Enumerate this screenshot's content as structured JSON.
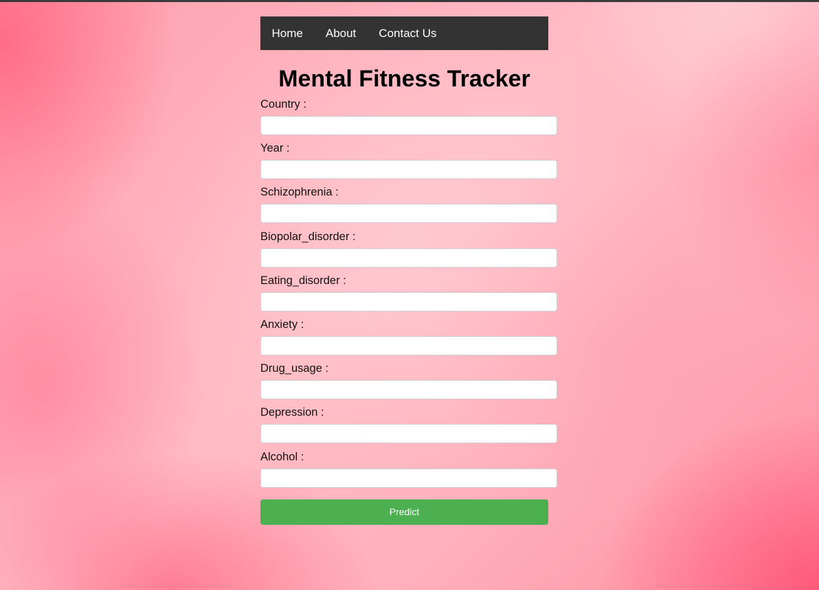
{
  "nav": {
    "items": [
      {
        "label": "Home"
      },
      {
        "label": "About"
      },
      {
        "label": "Contact Us"
      }
    ]
  },
  "page": {
    "title": "Mental Fitness Tracker"
  },
  "form": {
    "fields": [
      {
        "label": "Country :",
        "value": ""
      },
      {
        "label": "Year :",
        "value": ""
      },
      {
        "label": "Schizophrenia :",
        "value": ""
      },
      {
        "label": "Biopolar_disorder :",
        "value": ""
      },
      {
        "label": "Eating_disorder :",
        "value": ""
      },
      {
        "label": "Anxiety :",
        "value": ""
      },
      {
        "label": "Drug_usage :",
        "value": ""
      },
      {
        "label": "Depression :",
        "value": ""
      },
      {
        "label": "Alcohol :",
        "value": ""
      }
    ],
    "submit_label": "Predict"
  },
  "colors": {
    "navbar": "#333333",
    "button": "#4caf50",
    "background": "#ffb3bd"
  }
}
